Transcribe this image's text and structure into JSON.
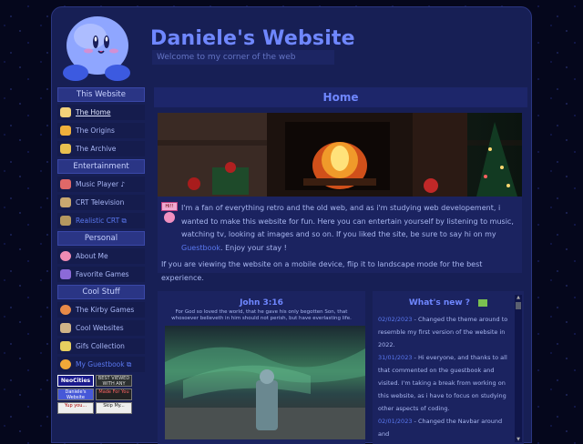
{
  "header": {
    "title": "Daniele's Website",
    "subtitle": "Welcome to my corner of the web"
  },
  "sidebar": {
    "sections": [
      {
        "heading": "This Website",
        "items": [
          {
            "label": "The Home",
            "icon": "home-icon",
            "active": true,
            "external": false
          },
          {
            "label": "The Origins",
            "icon": "star-icon",
            "active": false,
            "external": false
          },
          {
            "label": "The Archive",
            "icon": "archive-icon",
            "active": false,
            "external": false
          }
        ]
      },
      {
        "heading": "Entertainment",
        "items": [
          {
            "label": "Music Player ♪",
            "icon": "music-icon",
            "active": false,
            "external": false
          },
          {
            "label": "CRT Television",
            "icon": "tv-icon",
            "active": false,
            "external": false
          },
          {
            "label": "Realistic CRT ⧉",
            "icon": "crt-icon",
            "active": false,
            "external": true
          }
        ]
      },
      {
        "heading": "Personal",
        "items": [
          {
            "label": "About Me",
            "icon": "kirby-icon",
            "active": false,
            "external": false
          },
          {
            "label": "Favorite Games",
            "icon": "games-icon",
            "active": false,
            "external": false
          }
        ]
      },
      {
        "heading": "Cool Stuff",
        "items": [
          {
            "label": "The Kirby Games",
            "icon": "kirby-games-icon",
            "active": false,
            "external": false
          },
          {
            "label": "Cool Websites",
            "icon": "websites-icon",
            "active": false,
            "external": false
          },
          {
            "label": "Gifs Collection",
            "icon": "gif-icon",
            "active": false,
            "external": false
          },
          {
            "label": "My Guestbook ⧉",
            "icon": "guestbook-icon",
            "active": false,
            "external": true
          }
        ]
      }
    ],
    "badges": [
      [
        "NeoCities",
        "BEST VIEWED WITH ANY BROWSER"
      ],
      [
        "Daniele's Website",
        "Made For You"
      ],
      [
        "Yup you...",
        "Skip My..."
      ]
    ]
  },
  "main": {
    "title": "Home",
    "intro_para1_a": "I'm a fan of everything retro and the old web, and as i'm studying web developement, i wanted to make this website for fun. Here you can entertain yourself by listening to music, watching tv, looking at images and so on. If you liked the site, be sure to say hi on my ",
    "intro_link": "Guestbook",
    "intro_para1_b": ". Enjoy your stay !",
    "intro_para2": "If you are viewing the website on a mobile device, flip it to landscape mode for the best experience.",
    "hi_badge": "Hi!!"
  },
  "verse": {
    "title": "John 3:16",
    "text": "For God so loved the world, that he gave his only begotten Son, that whosoever believeth in him should not perish, but have everlasting life."
  },
  "news": {
    "title": "What's new ?",
    "entries": [
      {
        "date": "02/02/2023",
        "text": " - Changed the theme around to resemble my first version of the website in 2022."
      },
      {
        "date": "31/01/2023",
        "text": " - Hi everyone, and thanks to all that commented on the guestbook and visited. I'm taking a break from working on this website, as i have to focus on studying other aspects of coding."
      },
      {
        "date": "02/01/2023",
        "text": " - Changed the Navbar around and"
      }
    ]
  },
  "colors": {
    "accent": "#6f87ff",
    "link": "#5a78f0",
    "panel": "#1b2360",
    "background": "#05071c"
  }
}
